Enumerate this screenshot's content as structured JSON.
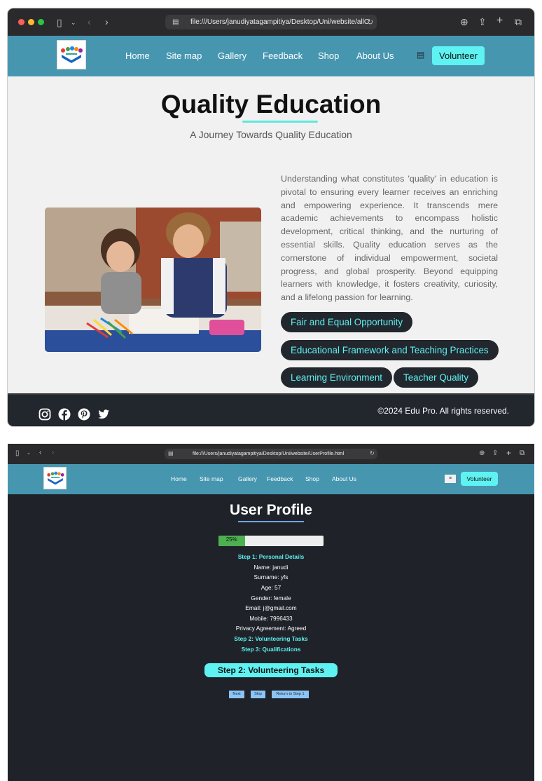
{
  "colors": {
    "nav": "#4796b0",
    "accent": "#5ef2f2",
    "dark": "#22262d",
    "progress": "#4caf50"
  },
  "window1": {
    "url": "file:///Users/janudiyatagampitiya/Desktop/Uni/website/allC",
    "nav": [
      "Home",
      "Site map",
      "Gallery",
      "Feedback",
      "Shop",
      "About Us"
    ],
    "volunteer": "Volunteer",
    "title": "Quality Education",
    "subtitle": "A Journey Towards Quality Education",
    "paragraph": "Understanding what constitutes 'quality' in education is pivotal to ensuring every learner receives an enriching and empowering experience. It transcends mere academic achievements to encompass holistic development, critical thinking, and the nurturing of essential skills. Quality education serves as the cornerstone of individual empowerment, societal progress, and global prosperity. Beyond equipping learners with knowledge, it fosters creativity, curiosity, and a lifelong passion for learning.",
    "pills": [
      "Fair and Equal Opportunity",
      "Educational Framework and Teaching Practices",
      "Learning Environment",
      "Teacher Quality"
    ],
    "social_icons": [
      "instagram-icon",
      "facebook-icon",
      "pinterest-icon",
      "twitter-icon"
    ],
    "copyright": "©2024 Edu Pro. All rights reserved."
  },
  "window2": {
    "url": "file:///Users/janudiyatagampitiya/Desktop/Uni/website/UserProfile.html",
    "nav": [
      "Home",
      "Site map",
      "Gallery",
      "Feedback",
      "Shop",
      "About Us"
    ],
    "volunteer": "Volunteer",
    "title": "User Profile",
    "progress_label": "25%",
    "progress_value": 0.25,
    "step1": "Step 1: Personal Details",
    "details": [
      "Name: janudi",
      "Surname: yfs",
      "Age: 57",
      "Gender: female",
      "Email: j@gmail.com",
      "Mobile: 7996433",
      "Privacy Agreement: Agreed"
    ],
    "step2": "Step 2: Volunteering Tasks",
    "step3": "Step 3: Qualifications",
    "current_step": "Step 2: Volunteering Tasks",
    "buttons": [
      "Next",
      "Skip",
      "Return to Step 1"
    ]
  }
}
